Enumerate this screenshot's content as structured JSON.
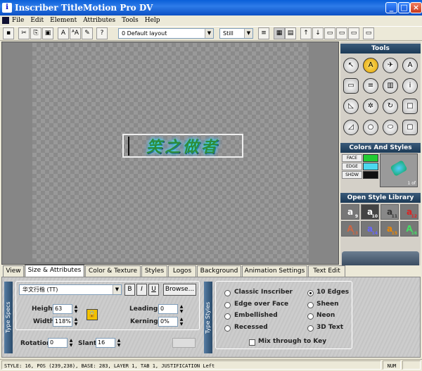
{
  "window": {
    "title": "Inscriber TitleMotion Pro DV",
    "minimize": "_",
    "maximize": "□",
    "close": "×"
  },
  "menu": [
    "File",
    "Edit",
    "Element",
    "Attributes",
    "Tools",
    "Help"
  ],
  "toolbar": {
    "layout_select": "0 Default layout",
    "mode_select": "Still"
  },
  "canvas": {
    "text": "笑之做者"
  },
  "tools_panel": {
    "title": "Tools"
  },
  "colors_panel": {
    "title": "Colors And Styles",
    "rows": [
      "FACE",
      "EDGE",
      "SHDW"
    ],
    "footer": "1 of"
  },
  "library_panel": {
    "title": "Open Style Library",
    "thumbs": [
      {
        "glyph": "a",
        "num": "9"
      },
      {
        "glyph": "a",
        "num": "10"
      },
      {
        "glyph": "a",
        "num": "11"
      },
      {
        "glyph": "a",
        "num": "12"
      },
      {
        "glyph": "A",
        "num": "13"
      },
      {
        "glyph": "a",
        "num": "14"
      },
      {
        "glyph": "a",
        "num": "15"
      },
      {
        "glyph": "A",
        "num": "16"
      }
    ]
  },
  "tabs": [
    "View",
    "Size & Attributes",
    "Color & Texture",
    "Styles",
    "Logos",
    "Background",
    "Animation Settings",
    "Text Edit"
  ],
  "type_specs": {
    "side_label": "Type Specs",
    "font": "华文行楷  (TT)",
    "bold": "B",
    "italic": "I",
    "underline": "U",
    "browse": "Browse...",
    "height_label": "Height",
    "height": "63",
    "width_label": "Width",
    "width": "118%",
    "leading_label": "Leading",
    "leading": "0",
    "kerning_label": "Kerning",
    "kerning": "0%",
    "rotation_label": "Rotation",
    "rotation": "0",
    "slant_label": "Slant",
    "slant": "16"
  },
  "type_styles": {
    "side_label": "Type Styles",
    "options": [
      "Classic Inscriber",
      "Edge over Face",
      "Embellished",
      "Recessed",
      "10 Edges",
      "Sheen",
      "Neon",
      "3D Text"
    ],
    "selected": "10 Edges",
    "mix_label": "Mix  through to Key"
  },
  "status": {
    "line": "STYLE: 16, POS (239,238), BASE: 283, LAYER 1, TAB 1, JUSTIFICATION Left",
    "num": "NUM"
  }
}
